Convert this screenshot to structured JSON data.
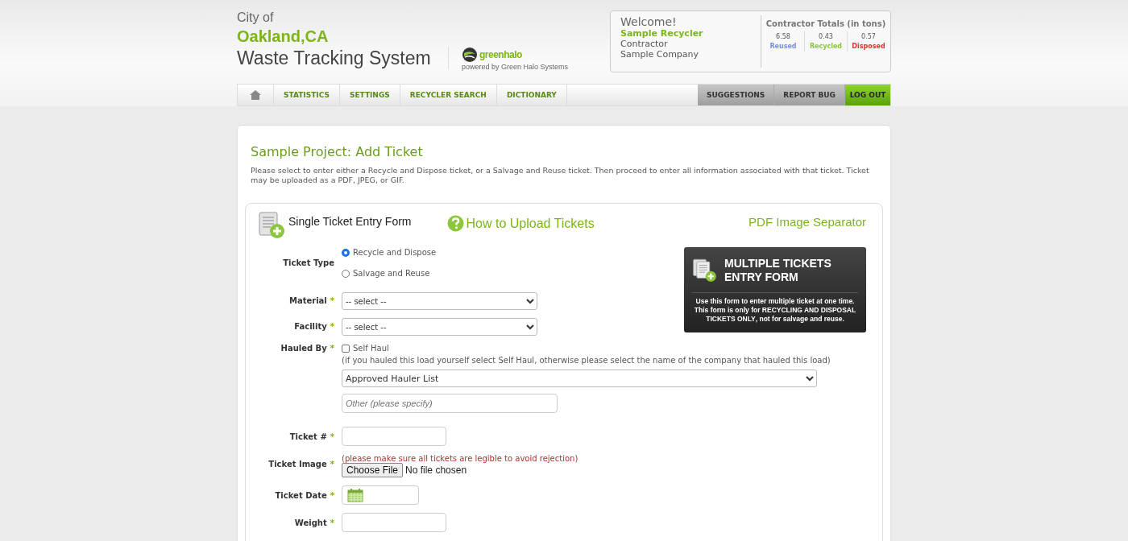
{
  "header": {
    "city_prefix": "City of",
    "city": "Oakland,CA",
    "system": "Waste Tracking System",
    "brand": "greenhalo",
    "brand_tagline": "powered by Green Halo Systems"
  },
  "welcome": {
    "greeting": "Welcome!",
    "user": "Sample Recycler",
    "role": "Contractor",
    "company": "Sample Company"
  },
  "totals": {
    "title": "Contractor Totals (in tons)",
    "items": [
      {
        "value": "6.58",
        "label": "Reused",
        "color": "#7b8fe0"
      },
      {
        "value": "0.43",
        "label": "Recycled",
        "color": "#8cc63f"
      },
      {
        "value": "0.57",
        "label": "Disposed",
        "color": "#e03131"
      }
    ]
  },
  "nav": {
    "left": [
      "STATISTICS",
      "SETTINGS",
      "RECYCLER SEARCH",
      "DICTIONARY"
    ],
    "right": [
      {
        "label": "SUGGESTIONS",
        "kind": "grey"
      },
      {
        "label": "REPORT BUG",
        "kind": "grey"
      },
      {
        "label": "LOG OUT",
        "kind": "green"
      }
    ]
  },
  "page": {
    "title": "Sample Project: Add Ticket",
    "intro": "Please select to enter either a Recycle and Dispose ticket, or a Salvage and Reuse ticket. Then proceed to enter all information associated with that ticket. Ticket may be uploaded as a PDF, JPEG, or GIF."
  },
  "form": {
    "title": "Single Ticket Entry Form",
    "help_link": "How to Upload Tickets",
    "separator_link": "PDF Image Separator",
    "multi_banner": {
      "title": "**MULTIPLE** TICKETS ENTRY FORM",
      "text": "Use this form to enter multiple ticket at one time. This form is only for **RECYCLING AND DISPOSAL TICKETS ONLY**, not for salvage and reuse."
    },
    "fields": [
      {
        "kind": "radio",
        "label": "Ticket Type",
        "options": [
          {
            "label": "Recycle and Dispose",
            "selected": true
          },
          {
            "label": "Salvage and Reuse",
            "selected": false
          }
        ]
      },
      {
        "kind": "select",
        "label": "Material",
        "required_mark": "*",
        "value": "-- select --"
      },
      {
        "kind": "select",
        "label": "Facility",
        "required_mark": "*",
        "value": "-- select --"
      },
      {
        "kind": "hauled",
        "label": "Hauled By",
        "required_mark": "*",
        "checkbox": {
          "label": "Self Haul",
          "checked": false
        },
        "note": "(if you hauled this load yourself select Self Haul, otherwise please select the name of the company that hauled this load)",
        "select_value": "Approved Hauler List",
        "other_placeholder": "Other (please specify)"
      },
      {
        "kind": "text",
        "label": "Ticket #",
        "required_mark": "*"
      },
      {
        "kind": "file",
        "label": "Ticket Image",
        "required_mark": "*",
        "note": "(please make sure all tickets are legible to avoid rejection)",
        "button": "Choose File",
        "status": "No file chosen"
      },
      {
        "kind": "date",
        "label": "Ticket Date",
        "required_mark": "*"
      },
      {
        "kind": "text",
        "label": "Weight",
        "required_mark": "*"
      }
    ]
  }
}
